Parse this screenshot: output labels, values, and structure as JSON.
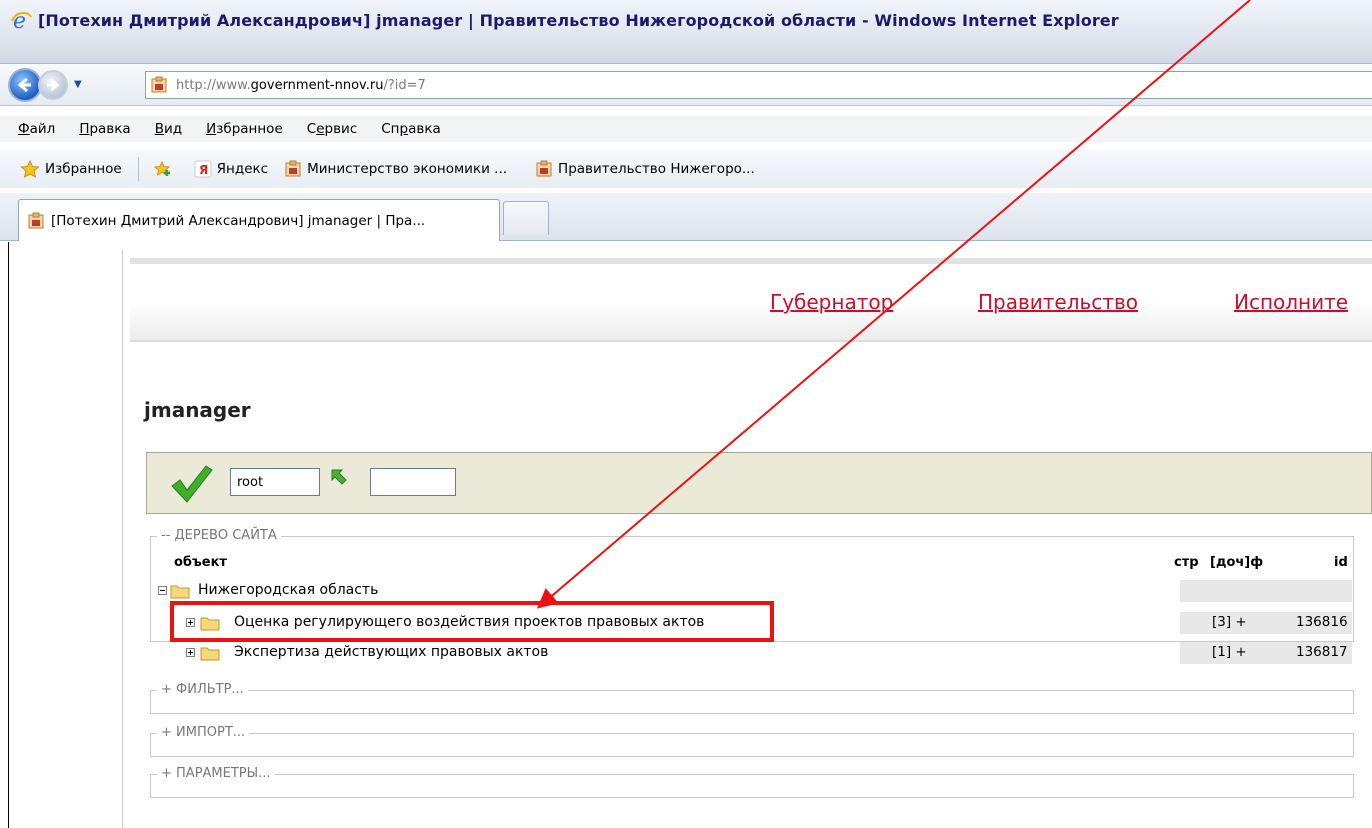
{
  "window": {
    "title": "[Потехин Дмитрий Александрович] jmanager | Правительство Нижегородской области - Windows Internet Explorer"
  },
  "address_bar": {
    "scheme": "http://www.",
    "host": "government-nnov.ru",
    "path": "/?id=7"
  },
  "menu": {
    "items": [
      {
        "pre": "",
        "accel": "Ф",
        "post": "айл"
      },
      {
        "pre": "",
        "accel": "П",
        "post": "равка"
      },
      {
        "pre": "",
        "accel": "В",
        "post": "ид"
      },
      {
        "pre": "",
        "accel": "И",
        "post": "збранное"
      },
      {
        "pre": "С",
        "accel": "е",
        "post": "рвис"
      },
      {
        "pre": "Сп",
        "accel": "р",
        "post": "авка"
      }
    ]
  },
  "favorites_bar": {
    "favorites_label": "Избранное",
    "links": [
      "Яндекс",
      "Министерство экономики ...",
      "Правительство Нижегоро..."
    ]
  },
  "tabs": {
    "active_label": "[Потехин Дмитрий Александрович] jmanager | Пра..."
  },
  "site_nav": {
    "links": [
      "Губернатор",
      "Правительство",
      "Исполните"
    ]
  },
  "page": {
    "title": "jmanager"
  },
  "toolbar": {
    "root_value": "root",
    "second_value": ""
  },
  "tree": {
    "legend": "-- ДЕРЕВО САЙТА",
    "columns": {
      "object": "объект",
      "pages": "стр",
      "children": "[доч]ф",
      "id": "id"
    },
    "rows": [
      {
        "label": "Нижегородская область",
        "children": "",
        "id": ""
      },
      {
        "label": "Оценка регулирующего воздействия проектов правовых актов",
        "children": "[3] +",
        "id": "136816"
      },
      {
        "label": "Экспертиза действующих правовых актов",
        "children": "[1] +",
        "id": "136817"
      }
    ]
  },
  "sections": {
    "filter": "+ ФИЛЬТР...",
    "import": "+ ИМПОРТ...",
    "params": "+ ПАРАМЕТРЫ..."
  },
  "colors": {
    "annotation": "#ee1111",
    "site_link": "#c8102e",
    "toolbar_bg": "#ebe9d8"
  }
}
